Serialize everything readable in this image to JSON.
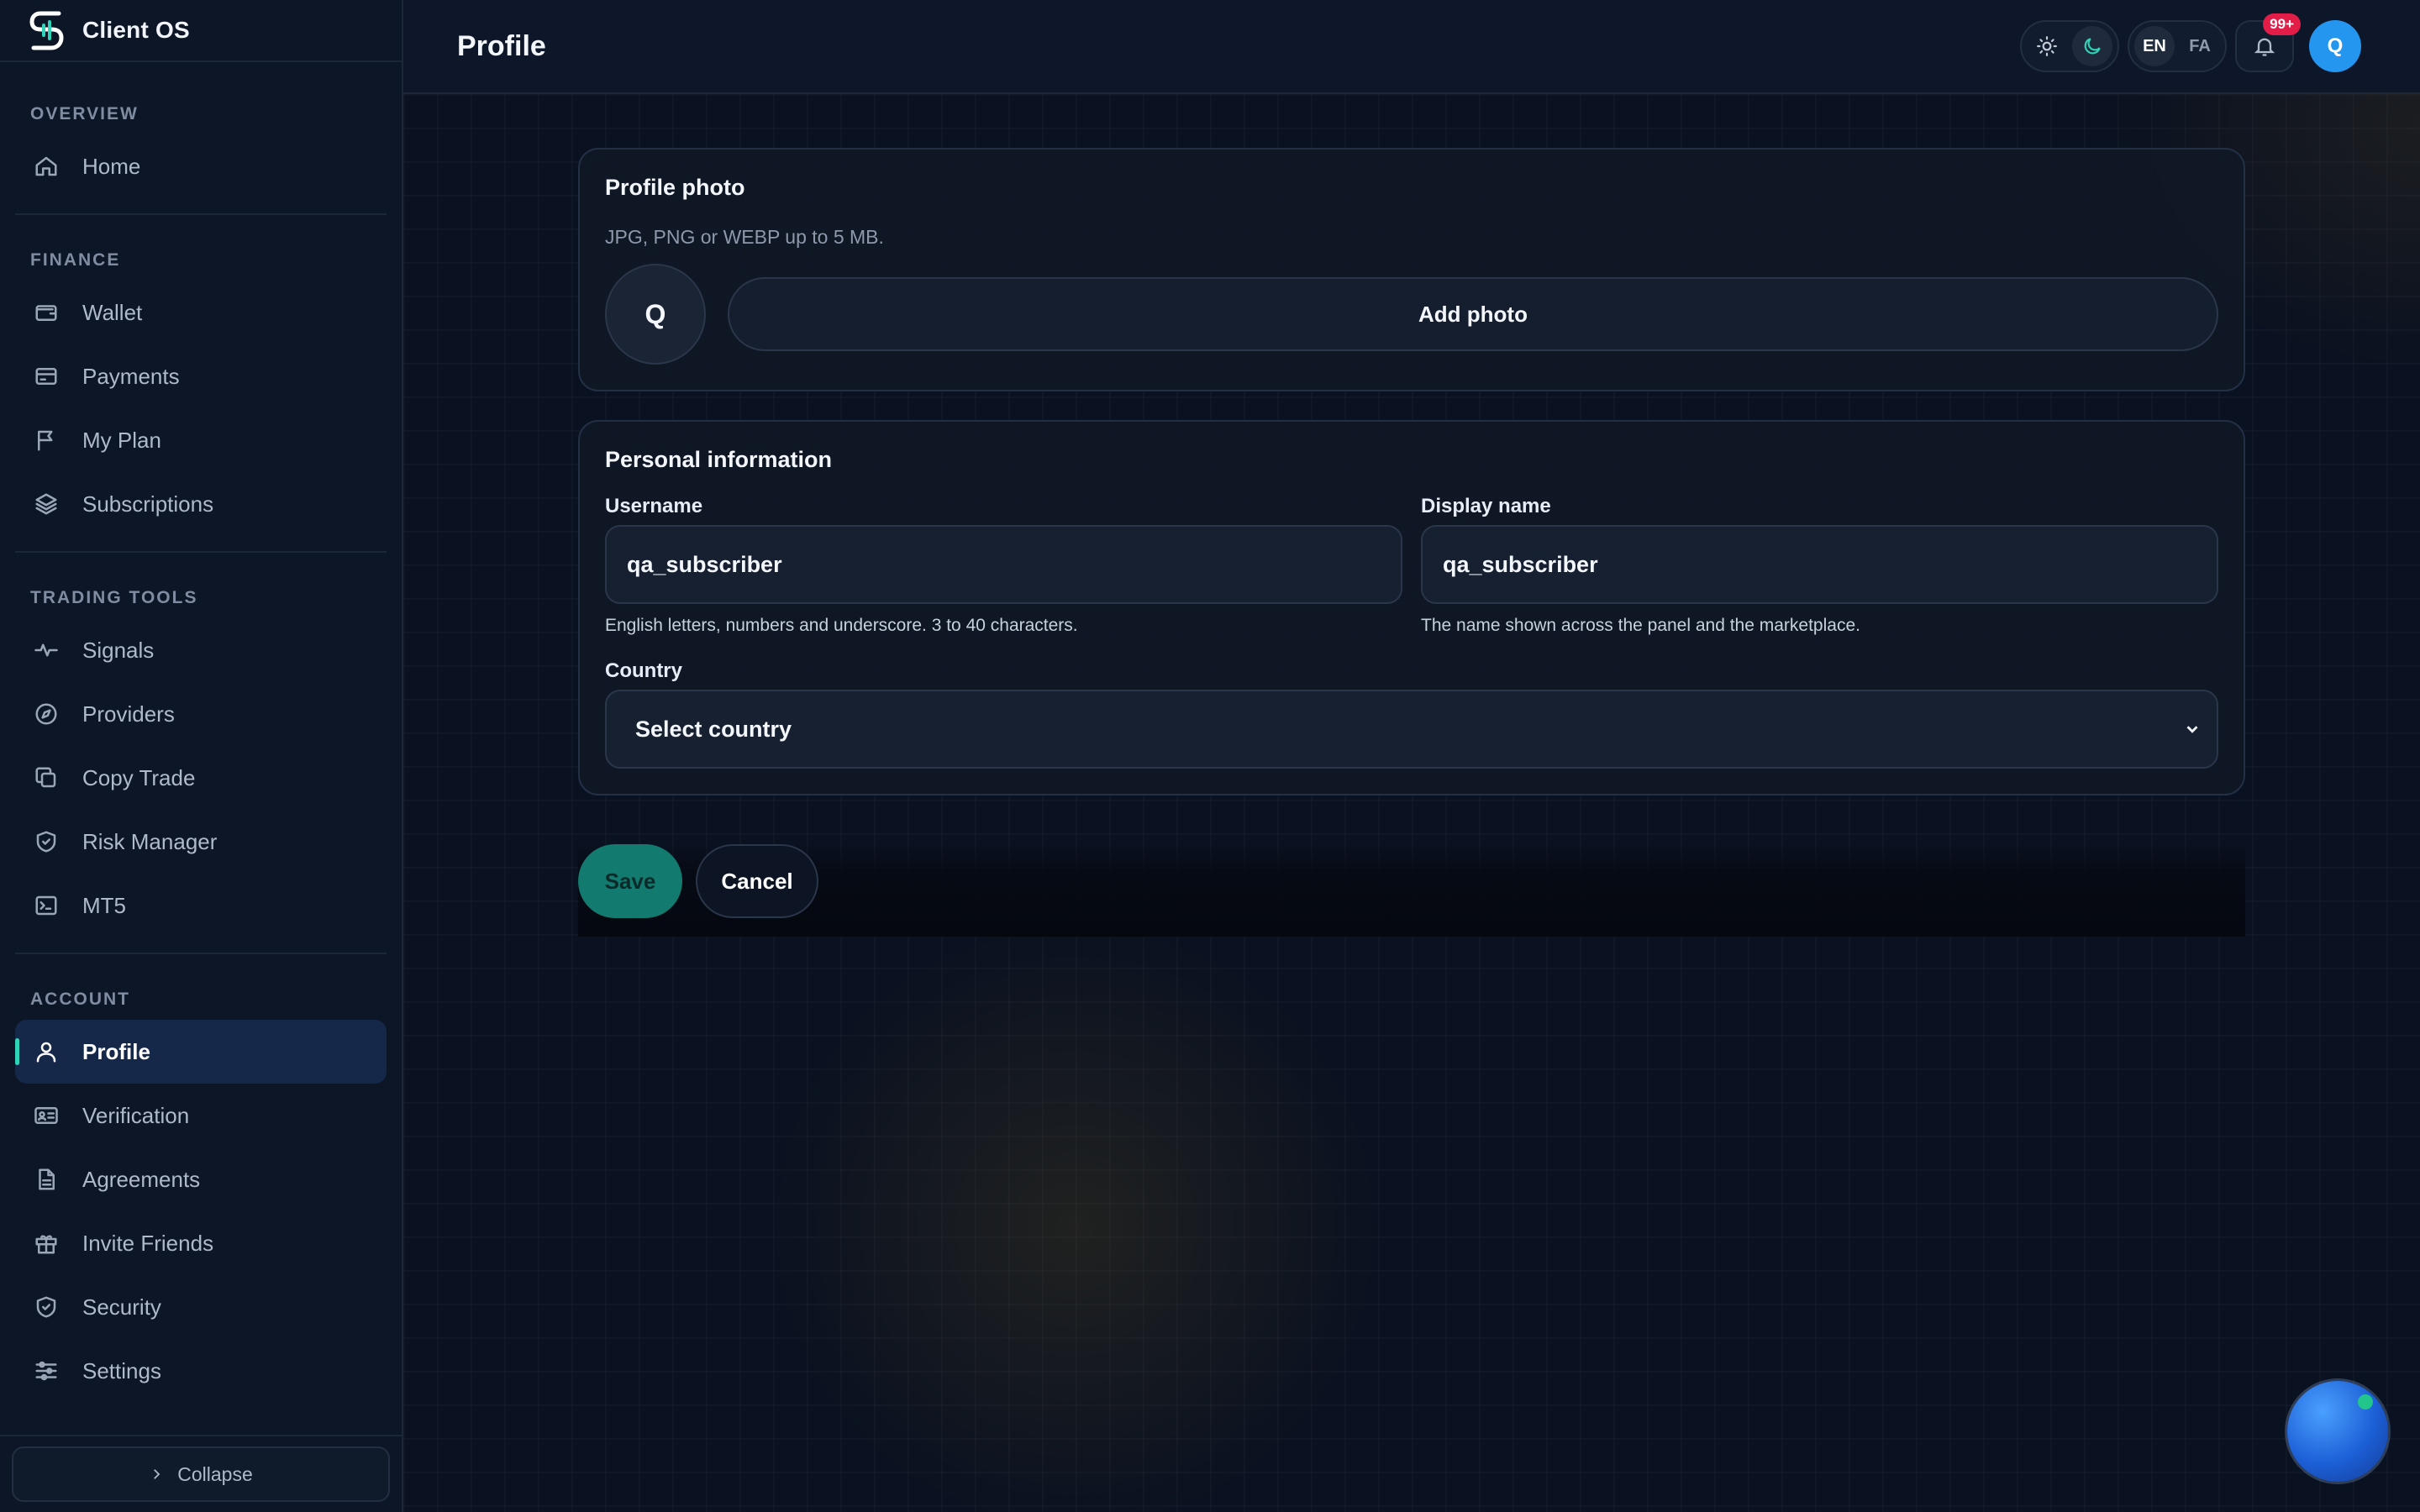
{
  "app": {
    "name": "Client OS"
  },
  "header": {
    "title": "Profile",
    "lang_en": "EN",
    "lang_fa": "FA",
    "notifications_badge": "99+",
    "avatar_initial": "Q"
  },
  "sidebar": {
    "sections": [
      {
        "heading": "OVERVIEW",
        "items": [
          {
            "label": "Home",
            "icon": "home-icon"
          }
        ]
      },
      {
        "heading": "FINANCE",
        "items": [
          {
            "label": "Wallet",
            "icon": "wallet-icon"
          },
          {
            "label": "Payments",
            "icon": "credit-card-icon"
          },
          {
            "label": "My Plan",
            "icon": "flag-icon"
          },
          {
            "label": "Subscriptions",
            "icon": "layers-icon"
          }
        ]
      },
      {
        "heading": "TRADING TOOLS",
        "items": [
          {
            "label": "Signals",
            "icon": "activity-icon"
          },
          {
            "label": "Providers",
            "icon": "compass-icon"
          },
          {
            "label": "Copy Trade",
            "icon": "copy-icon"
          },
          {
            "label": "Risk Manager",
            "icon": "shield-check-icon"
          },
          {
            "label": "MT5",
            "icon": "terminal-icon"
          }
        ]
      },
      {
        "heading": "ACCOUNT",
        "items": [
          {
            "label": "Profile",
            "icon": "user-icon",
            "active": true
          },
          {
            "label": "Verification",
            "icon": "id-card-icon"
          },
          {
            "label": "Agreements",
            "icon": "document-icon"
          },
          {
            "label": "Invite Friends",
            "icon": "gift-icon"
          },
          {
            "label": "Security",
            "icon": "shield-icon"
          },
          {
            "label": "Settings",
            "icon": "sliders-icon"
          }
        ]
      }
    ],
    "collapse_label": "Collapse"
  },
  "profile_photo": {
    "title": "Profile photo",
    "subtitle": "JPG, PNG or WEBP up to 5 MB.",
    "avatar_initial": "Q",
    "add_photo_label": "Add photo"
  },
  "personal_info": {
    "title": "Personal information",
    "username": {
      "label": "Username",
      "value": "qa_subscriber",
      "hint": "English letters, numbers and underscore. 3 to 40 characters."
    },
    "display_name": {
      "label": "Display name",
      "value": "qa_subscriber",
      "hint": "The name shown across the panel and the marketplace."
    },
    "country": {
      "label": "Country",
      "value": "Select country"
    }
  },
  "actions": {
    "save_label": "Save",
    "cancel_label": "Cancel"
  },
  "colors": {
    "accent": "#2fd3b8",
    "save_button": "#137a70",
    "badge": "#e11d48",
    "avatar": "#2596f0",
    "active_nav_bg": "#16284a"
  }
}
